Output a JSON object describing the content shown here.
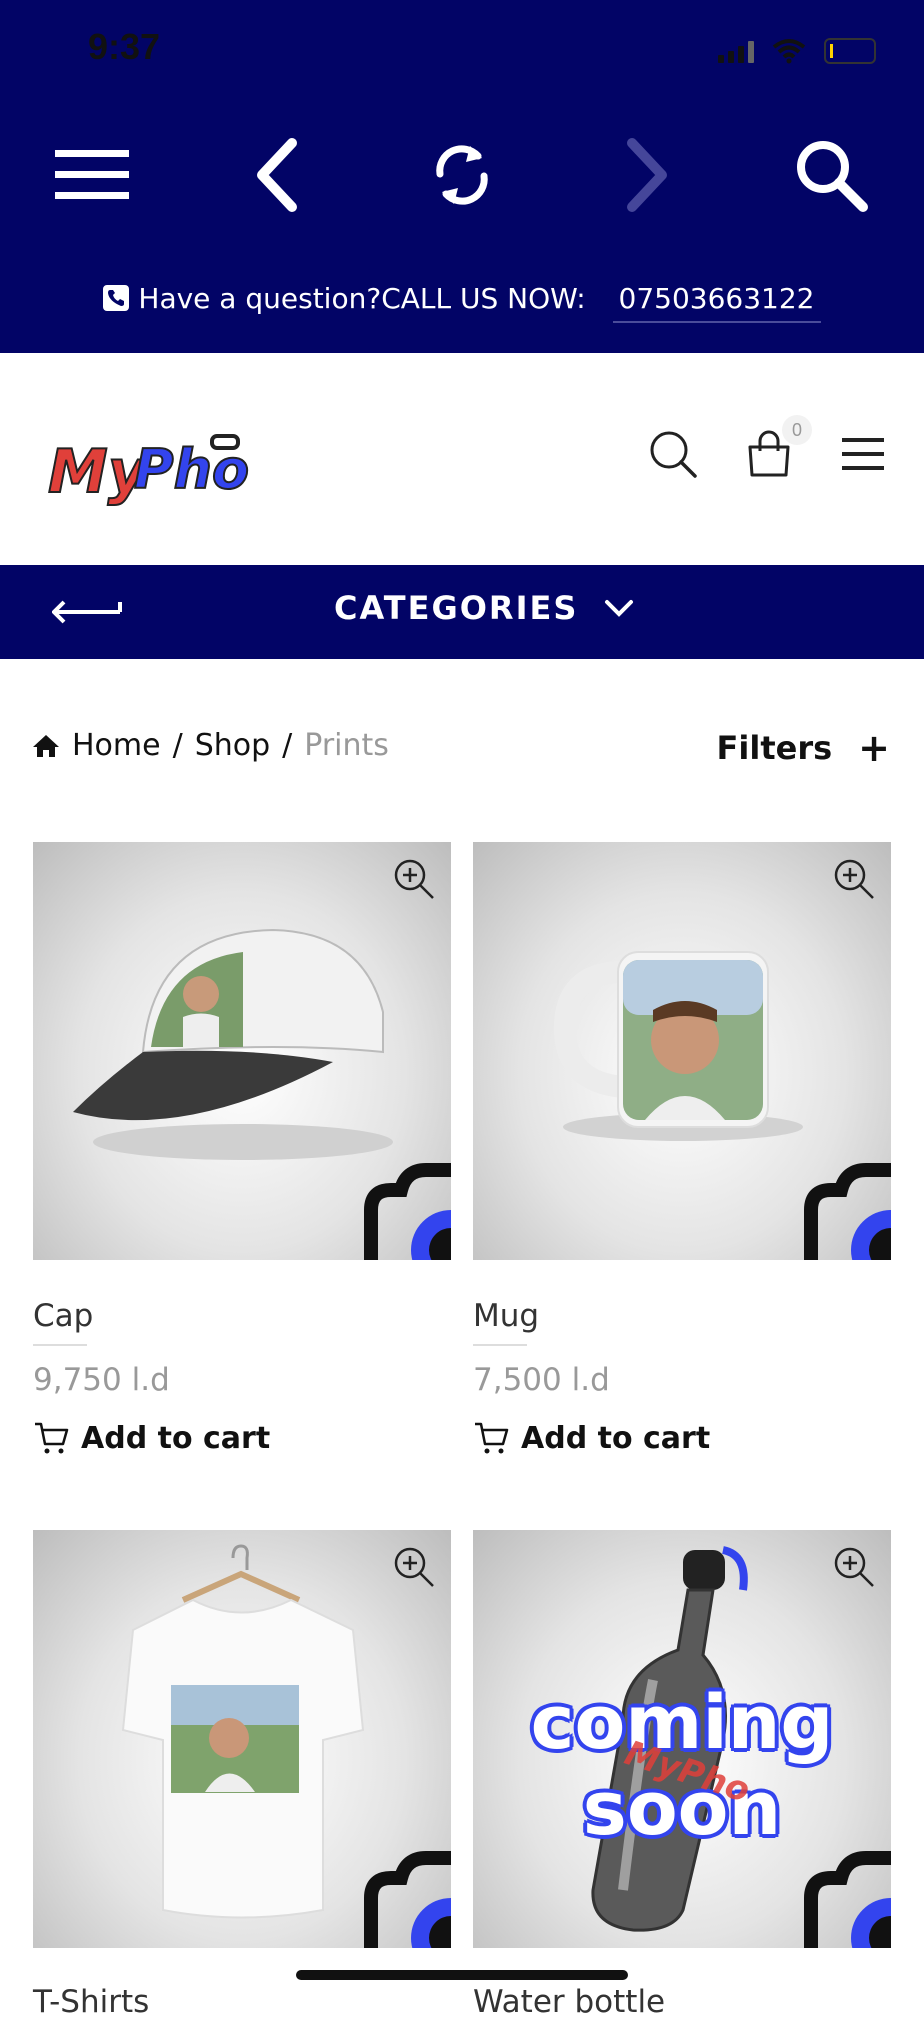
{
  "status": {
    "time": "9:37"
  },
  "contact": {
    "question": "Have a question?CALL US NOW:",
    "phone": "07503663122"
  },
  "header": {
    "logo_text": "MyPho",
    "cart_count": "0"
  },
  "categories": {
    "label": "CATEGORIES"
  },
  "breadcrumb": {
    "home": "Home",
    "sep1": "/",
    "shop": "Shop",
    "sep2": "/",
    "current": "Prints"
  },
  "filters": {
    "label": "Filters",
    "plus": "+"
  },
  "products": [
    {
      "title": "Cap",
      "price": "9,750 l.d",
      "add_label": "Add to cart"
    },
    {
      "title": "Mug",
      "price": "7,500 l.d",
      "add_label": "Add to cart"
    },
    {
      "title": "T-Shirts"
    },
    {
      "title": "Water bottle",
      "overlay_line1": "coming",
      "overlay_line2": "soon",
      "overlay_logo": "MyPho"
    }
  ],
  "colors": {
    "brand_navy": "#020466",
    "accent_blue": "#3344ee",
    "logo_red": "#e0403a"
  }
}
